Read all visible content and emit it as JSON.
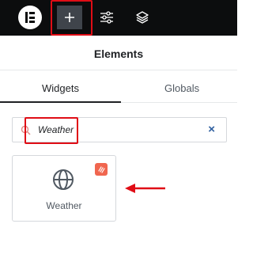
{
  "toolbar": {
    "logo_icon": "elementor-logo-icon",
    "add_icon": "plus-icon",
    "settings_icon": "sliders-icon",
    "structure_icon": "layers-icon",
    "background": "#0c0d0e",
    "highlight_color": "#e00d16"
  },
  "panel": {
    "title": "Elements",
    "tabs": [
      {
        "label": "Widgets",
        "active": true
      },
      {
        "label": "Globals",
        "active": false
      }
    ]
  },
  "search": {
    "value": "Weather",
    "icon": "search-icon",
    "clear_label": "×"
  },
  "widgets": [
    {
      "label": "Weather",
      "icon": "globe-icon",
      "pro_badge_icon": "pro-badge-icon",
      "badge_color": "#f0664f"
    }
  ],
  "annotation": {
    "arrow_icon": "left-arrow-icon",
    "color": "#e00d16"
  }
}
